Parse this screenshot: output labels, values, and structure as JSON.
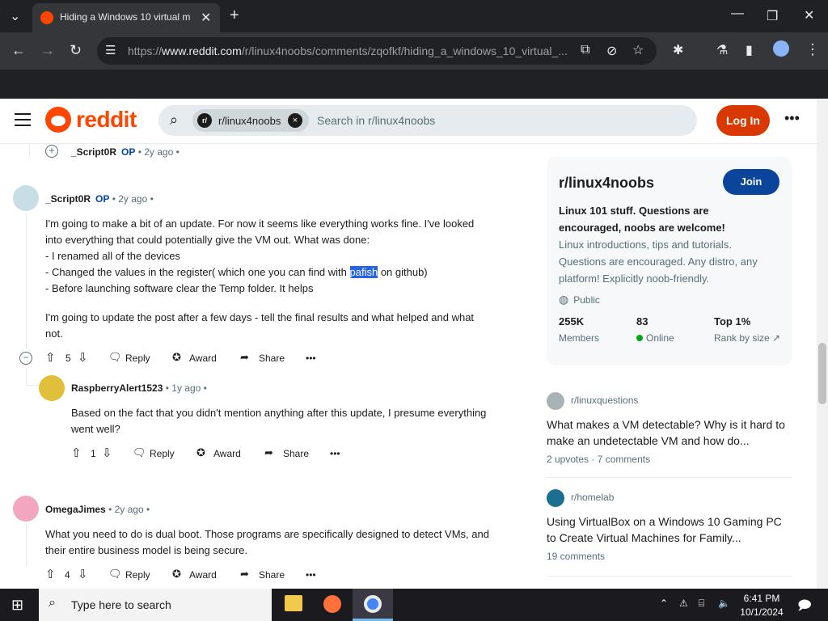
{
  "browser": {
    "tab_title": "Hiding a Windows 10 virtual m",
    "url_prefix": "https://",
    "url_domain": "www.reddit.com",
    "url_path": "/r/linux4noobs/comments/zqofkf/hiding_a_windows_10_virtual_..."
  },
  "header": {
    "logo_text": "reddit",
    "search_chip": "r/linux4noobs",
    "search_placeholder": "Search in r/linux4noobs",
    "login": "Log In"
  },
  "collapsed_comment": {
    "user": "_Script0R",
    "op": "OP",
    "time": "• 2y ago •"
  },
  "comments": [
    {
      "user": "_Script0R",
      "op": "OP",
      "time": "• 2y ago •",
      "lines": [
        "I'm going to make a bit of an update. For now it seems like everything works fine. I've looked",
        "into everything that could potentially give the VM out. What was done:",
        "- I renamed all of the devices"
      ],
      "line4_before": "- Changed the values in the register( which one you can find with ",
      "line4_highlight": "pafish",
      "line4_after": " on github)",
      "line5": "- Before launching software clear the Temp folder. It helps",
      "para2_l1": "I'm going to update the post after a few days - tell the final results and what helped and what",
      "para2_l2": "not.",
      "votes": "5",
      "reply": "Reply",
      "award": "Award",
      "share": "Share"
    },
    {
      "user": "RaspberryAlert1523",
      "time": "• 1y ago •",
      "l1": "Based on the fact that you didn't mention anything after this update, I presume everything",
      "l2": "went well?",
      "votes": "1",
      "reply": "Reply",
      "award": "Award",
      "share": "Share"
    },
    {
      "user": "OmegaJimes",
      "time": "• 2y ago •",
      "l1": "What you need to do is dual boot. Those programs are specifically designed to detect VMs, and",
      "l2": "their entire business model is being secure.",
      "votes": "4",
      "reply": "Reply",
      "award": "Award",
      "share": "Share"
    }
  ],
  "sidebar": {
    "name": "r/linux4noobs",
    "join": "Join",
    "tagline": "Linux 101 stuff. Questions are encouraged, noobs are welcome!",
    "description": "Linux introductions, tips and tutorials. Questions are encouraged. Any distro, any platform! Explicitly noob-friendly.",
    "visibility": "Public",
    "members_n": "255K",
    "members_l": "Members",
    "online_n": "83",
    "online_l": "Online",
    "rank_n": "Top 1%",
    "rank_l": "Rank by size"
  },
  "related": [
    {
      "sub": "r/linuxquestions",
      "title": "What makes a VM detectable? Why is it hard to make an undetectable VM and how do...",
      "upvotes": "2 upvotes",
      "sep": "·",
      "comments": "7 comments"
    },
    {
      "sub": "r/homelab",
      "title": "Using VirtualBox on a Windows 10 Gaming PC to Create Virtual Machines for Family...",
      "comments": "19 comments"
    }
  ],
  "taskbar": {
    "search_placeholder": "Type here to search",
    "time": "6:41 PM",
    "date": "10/1/2024"
  },
  "colors": {
    "reddit_orange": "#ff4500",
    "login_button": "#d93900",
    "join_button": "#0a449b",
    "op_badge": "#0045ac",
    "highlight": "#2563eb"
  }
}
